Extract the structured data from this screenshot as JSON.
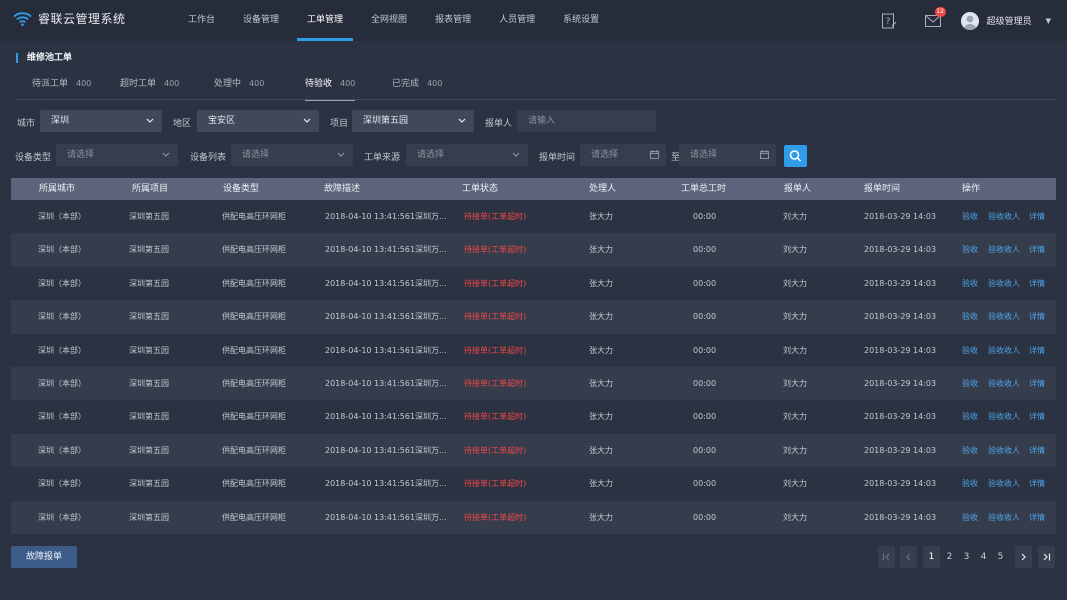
{
  "app": {
    "title": "睿联云管理系统"
  },
  "nav": [
    {
      "label": "工作台"
    },
    {
      "label": "设备管理"
    },
    {
      "label": "工单管理"
    },
    {
      "label": "全网视图"
    },
    {
      "label": "报表管理"
    },
    {
      "label": "人员管理"
    },
    {
      "label": "系统设置"
    }
  ],
  "header": {
    "mail_badge": "12",
    "user_name": "超级管理员",
    "active_nav": "工单管理"
  },
  "section": {
    "title": "维修池工单"
  },
  "tabs": [
    {
      "label": "待派工单",
      "count": "400"
    },
    {
      "label": "超时工单",
      "count": "400"
    },
    {
      "label": "处理中",
      "count": "400"
    },
    {
      "label": "待验收",
      "count": "400"
    },
    {
      "label": "已完成",
      "count": "400"
    }
  ],
  "filters": {
    "city_label": "城市",
    "city_value": "深圳",
    "district_label": "地区",
    "district_value": "宝安区",
    "project_label": "项目",
    "project_value": "深圳第五园",
    "reporter_label": "报单人",
    "reporter_placeholder": "请输入",
    "device_type_label": "设备类型",
    "device_type_placeholder": "请选择",
    "device_list_label": "设备列表",
    "device_list_placeholder": "请选择",
    "source_label": "工单来源",
    "source_placeholder": "请选择",
    "time_label": "报单时间",
    "time_start_placeholder": "请选择",
    "time_to": "至",
    "time_end_placeholder": "请选择"
  },
  "table": {
    "headers": [
      "所属城市",
      "所属项目",
      "设备类型",
      "故障描述",
      "工单状态",
      "处理人",
      "工单总工时",
      "报单人",
      "报单时间",
      "操作"
    ],
    "actions": [
      "验收",
      "验收收人",
      "详情"
    ],
    "rows": [
      {
        "city": "深圳（本部）",
        "project": "深圳第五园",
        "device": "供配电高压环网柜",
        "desc": "2018-04-10 13:41:561深圳万...",
        "status": "待接单(工单超时)",
        "handler": "张大力",
        "hours": "00:00",
        "reporter": "刘大力",
        "time": "2018-03-29 14:03"
      },
      {
        "city": "深圳（本部）",
        "project": "深圳第五园",
        "device": "供配电高压环网柜",
        "desc": "2018-04-10 13:41:561深圳万...",
        "status": "待接单(工单超时)",
        "handler": "张大力",
        "hours": "00:00",
        "reporter": "刘大力",
        "time": "2018-03-29 14:03"
      },
      {
        "city": "深圳（本部）",
        "project": "深圳第五园",
        "device": "供配电高压环网柜",
        "desc": "2018-04-10 13:41:561深圳万...",
        "status": "待接单(工单超时)",
        "handler": "张大力",
        "hours": "00:00",
        "reporter": "刘大力",
        "time": "2018-03-29 14:03"
      },
      {
        "city": "深圳（本部）",
        "project": "深圳第五园",
        "device": "供配电高压环网柜",
        "desc": "2018-04-10 13:41:561深圳万...",
        "status": "待接单(工单超时)",
        "handler": "张大力",
        "hours": "00:00",
        "reporter": "刘大力",
        "time": "2018-03-29 14:03"
      },
      {
        "city": "深圳（本部）",
        "project": "深圳第五园",
        "device": "供配电高压环网柜",
        "desc": "2018-04-10 13:41:561深圳万...",
        "status": "待接单(工单超时)",
        "handler": "张大力",
        "hours": "00:00",
        "reporter": "刘大力",
        "time": "2018-03-29 14:03"
      },
      {
        "city": "深圳（本部）",
        "project": "深圳第五园",
        "device": "供配电高压环网柜",
        "desc": "2018-04-10 13:41:561深圳万...",
        "status": "待接单(工单超时)",
        "handler": "张大力",
        "hours": "00:00",
        "reporter": "刘大力",
        "time": "2018-03-29 14:03"
      },
      {
        "city": "深圳（本部）",
        "project": "深圳第五园",
        "device": "供配电高压环网柜",
        "desc": "2018-04-10 13:41:561深圳万...",
        "status": "待接单(工单超时)",
        "handler": "张大力",
        "hours": "00:00",
        "reporter": "刘大力",
        "time": "2018-03-29 14:03"
      },
      {
        "city": "深圳（本部）",
        "project": "深圳第五园",
        "device": "供配电高压环网柜",
        "desc": "2018-04-10 13:41:561深圳万...",
        "status": "待接单(工单超时)",
        "handler": "张大力",
        "hours": "00:00",
        "reporter": "刘大力",
        "time": "2018-03-29 14:03"
      },
      {
        "city": "深圳（本部）",
        "project": "深圳第五园",
        "device": "供配电高压环网柜",
        "desc": "2018-04-10 13:41:561深圳万...",
        "status": "待接单(工单超时)",
        "handler": "张大力",
        "hours": "00:00",
        "reporter": "刘大力",
        "time": "2018-03-29 14:03"
      },
      {
        "city": "深圳（本部）",
        "project": "深圳第五园",
        "device": "供配电高压环网柜",
        "desc": "2018-04-10 13:41:561深圳万...",
        "status": "待接单(工单超时)",
        "handler": "张大力",
        "hours": "00:00",
        "reporter": "刘大力",
        "time": "2018-03-29 14:03"
      }
    ]
  },
  "footer": {
    "report_button": "故障报单"
  },
  "pagination": {
    "pages": [
      "1",
      "2",
      "3",
      "4",
      "5"
    ],
    "current": "1"
  },
  "colors": {
    "accent": "#2f9de8",
    "danger": "#f04848",
    "link": "#4fa7ee",
    "background": "#2b3241"
  }
}
